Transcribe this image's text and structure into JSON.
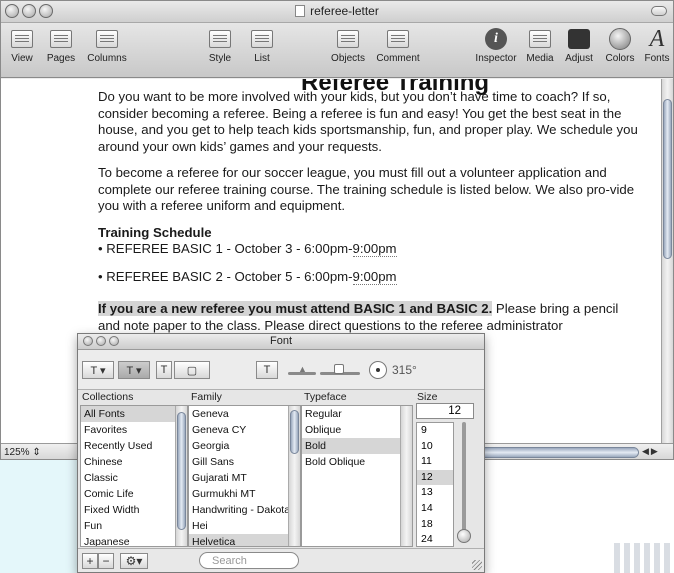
{
  "window": {
    "title": "referee-letter"
  },
  "toolbar": {
    "view": "View",
    "pages": "Pages",
    "columns": "Columns",
    "style": "Style",
    "list": "List",
    "objects": "Objects",
    "comment": "Comment",
    "inspector": "Inspector",
    "media": "Media",
    "adjust": "Adjust",
    "colors": "Colors",
    "fonts": "Fonts"
  },
  "document": {
    "heading": "Referee Training",
    "p1": "Do you want to be more involved with your kids, but you don’t have time to coach? If so, consider becoming a referee. Being a referee is fun and easy! You get the best seat in the house, and you get to help teach kids sportsmanship, fun, and proper play. We schedule you around your own kids’ games and your requests.",
    "p2": "To become a referee for our soccer league, you must fill out a volunteer application and complete our referee training course. The training schedule is listed below. We also pro-vide you with a referee uniform and equipment.",
    "schedule_title": "Training Schedule",
    "item1_text": "• REFEREE BASIC 1 - October 3 - 6:00pm-",
    "item1_end": "9:00pm",
    "item2_text": "• REFEREE BASIC 2 - October 5 - 6:00pm-",
    "item2_end": "9:00pm",
    "notice_highlight": "If you are a new referee you must attend BASIC 1 and BASIC 2.",
    "notice_rest": " Please bring a pencil and note paper to the class. Please direct questions to the referee administrator"
  },
  "statusbar": {
    "zoom": "125%"
  },
  "font_panel": {
    "title": "Font",
    "rotation": "315°",
    "headers": {
      "collections": "Collections",
      "family": "Family",
      "typeface": "Typeface",
      "size": "Size"
    },
    "collections": [
      "All Fonts",
      "Favorites",
      "Recently Used",
      "Chinese",
      "Classic",
      "Comic Life",
      "Fixed Width",
      "Fun",
      "Japanese"
    ],
    "families": [
      "Geneva",
      "Geneva CY",
      "Georgia",
      "Gill Sans",
      "Gujarati MT",
      "Gurmukhi MT",
      "Handwriting - Dakota",
      "Hei",
      "Helvetica"
    ],
    "typefaces": [
      "Regular",
      "Oblique",
      "Bold",
      "Bold Oblique"
    ],
    "size_value": "12",
    "sizes": [
      "9",
      "10",
      "11",
      "12",
      "13",
      "14",
      "18",
      "24"
    ],
    "search_placeholder": "Search"
  }
}
